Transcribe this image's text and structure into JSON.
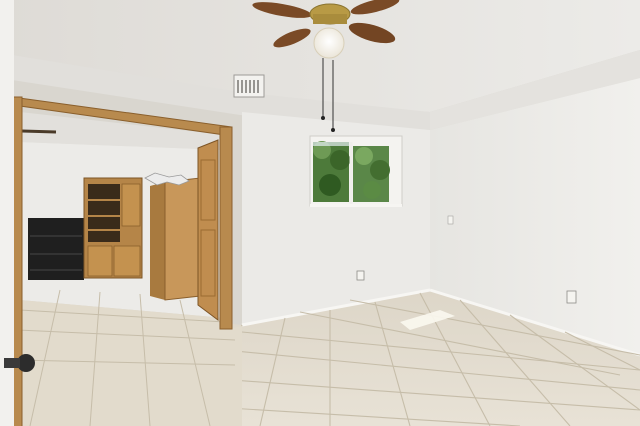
{
  "scene": {
    "description_visible_text": "",
    "colors": {
      "ceiling": "#e9e7e3",
      "wall": "#ecebe8",
      "wall_shadow": "#dcdad6",
      "floor_tile": "#e3dccd",
      "grout": "#c9c0ae",
      "wood": "#b88a4e",
      "wood_dark": "#8a5f2c",
      "brass": "#b89a45",
      "window_green": "#4d7a3a",
      "shelf_black": "#1f1f1f"
    }
  }
}
